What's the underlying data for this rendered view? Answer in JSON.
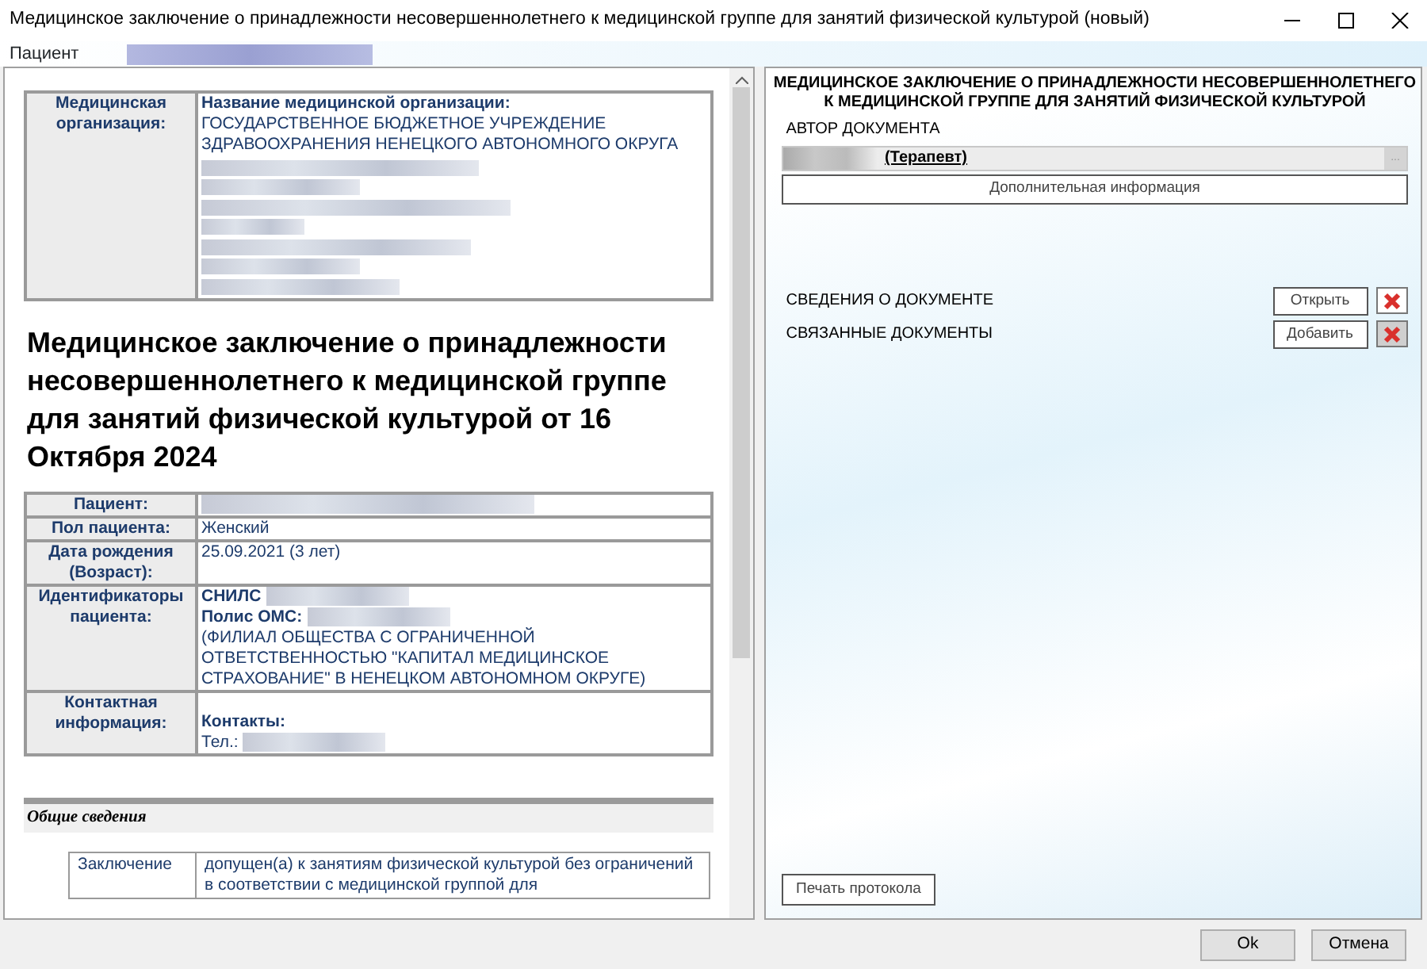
{
  "window": {
    "title": "Медицинское заключение о принадлежности несовершеннолетнего к медицинской группе для занятий физической культурой (новый)"
  },
  "patient_bar": {
    "label": "Пациент"
  },
  "document": {
    "org_table": {
      "label": "Медицинская организация:",
      "name_label": "Название медицинской организации:",
      "name": "ГОСУДАРСТВЕННОЕ БЮДЖЕТНОЕ УЧРЕЖДЕНИЕ ЗДРАВООХРАНЕНИЯ НЕНЕЦКОГО АВТОНОМНОГО ОКРУГА"
    },
    "heading": "Медицинское заключение о принадлежности несовершеннолетнего к медицинской группе для занятий физической культурой от 16 Октября 2024",
    "patient_table": [
      {
        "label": "Пациент:",
        "lines": [
          [
            {
              "kind": "redacted"
            }
          ]
        ]
      },
      {
        "label": "Пол пациента:",
        "lines": [
          [
            {
              "kind": "text",
              "text": "Женский"
            }
          ]
        ]
      },
      {
        "label": "Дата рождения (Возраст):",
        "lines": [
          [
            {
              "kind": "text",
              "text": "25.09.2021 (3 лет)"
            }
          ]
        ]
      },
      {
        "label": "Идентификаторы пациента:",
        "lines": [
          [
            {
              "kind": "bold",
              "text": "СНИЛС"
            },
            {
              "kind": "redacted"
            }
          ],
          [
            {
              "kind": "bold",
              "text": "Полис ОМС:"
            },
            {
              "kind": "redacted"
            },
            {
              "kind": "text",
              "text": "(ФИЛИАЛ ОБЩЕСТВА С ОГРАНИЧЕННОЙ ОТВЕТСТВЕННОСТЬЮ \"КАПИТАЛ МЕДИЦИНСКОЕ СТРАХОВАНИЕ\" В НЕНЕЦКОМ АВТОНОМНОМ ОКРУГЕ)"
            }
          ]
        ]
      },
      {
        "label": "Контактная информация:",
        "lines": [
          [
            {
              "kind": "bold",
              "text": "Контакты:"
            }
          ],
          [
            {
              "kind": "text",
              "text": "Тел.:"
            },
            {
              "kind": "redacted"
            }
          ]
        ]
      }
    ],
    "section_title": "Общие сведения",
    "conclusion": {
      "label": "Заключение",
      "value": "допущен(а) к занятиям физической культурой без ограничений в соответствии с медицинской группой для"
    }
  },
  "side_panel": {
    "title": "МЕДИЦИНСКОЕ ЗАКЛЮЧЕНИЕ О ПРИНАДЛЕЖНОСТИ НЕСОВЕРШЕННОЛЕТНЕГО К МЕДИЦИНСКОЙ ГРУППЕ ДЛЯ ЗАНЯТИЙ ФИЗИЧЕСКОЙ КУЛЬТУРОЙ",
    "author_label": "АВТОР ДОКУМЕНТА",
    "author_value": "(Терапевт)",
    "author_browse": "...",
    "additional_info_button": "Дополнительная информация",
    "sections": [
      {
        "label": "СВЕДЕНИЯ О ДОКУМЕНТЕ",
        "button": "Открыть",
        "delete_disabled": false
      },
      {
        "label": "СВЯЗАННЫЕ ДОКУМЕНТЫ",
        "button": "Добавить",
        "delete_disabled": true
      }
    ],
    "print_button": "Печать протокола"
  },
  "footer_buttons": [
    "Ok",
    "Отмена"
  ]
}
